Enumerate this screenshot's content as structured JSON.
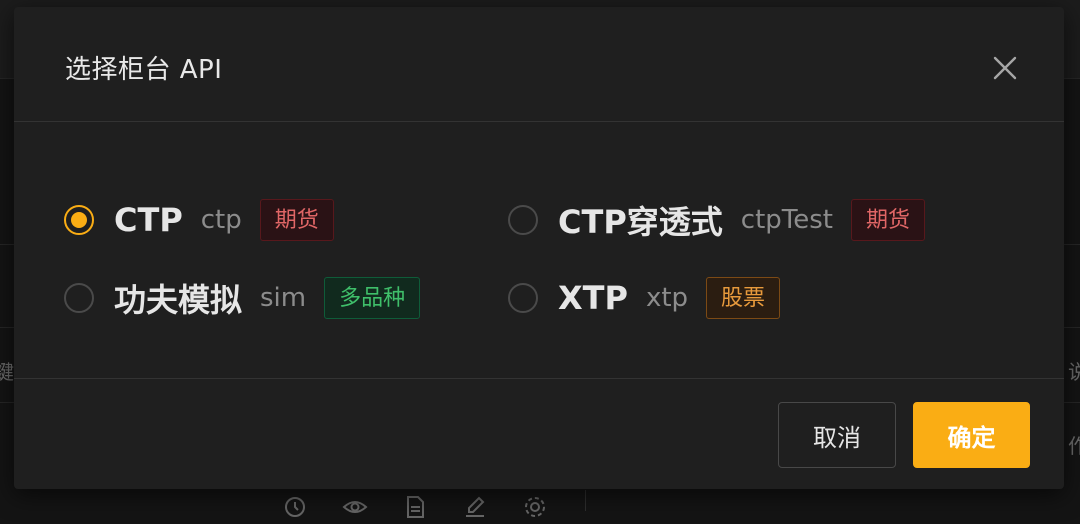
{
  "background": {
    "left_chars": [
      "鍵"
    ],
    "right_chars": [
      "说",
      "作"
    ],
    "toolbar_icons": [
      "history-icon",
      "eye-icon",
      "file-icon",
      "edit-icon",
      "gear-icon"
    ]
  },
  "modal": {
    "title": "选择柜台 API",
    "close_icon": "close-icon",
    "options": [
      {
        "name": "CTP",
        "code": "ctp",
        "tag": "期货",
        "tag_color": "red",
        "checked": true
      },
      {
        "name": "CTP穿透式",
        "code": "ctpTest",
        "tag": "期货",
        "tag_color": "red",
        "checked": false
      },
      {
        "name": "功夫模拟",
        "code": "sim",
        "tag": "多品种",
        "tag_color": "green",
        "checked": false
      },
      {
        "name": "XTP",
        "code": "xtp",
        "tag": "股票",
        "tag_color": "orange",
        "checked": false
      }
    ],
    "cancel_label": "取消",
    "ok_label": "确定"
  },
  "colors": {
    "accent": "#faad14",
    "tag_red": "#e06666",
    "tag_green": "#3fbf6a",
    "tag_orange": "#e89a3c"
  }
}
